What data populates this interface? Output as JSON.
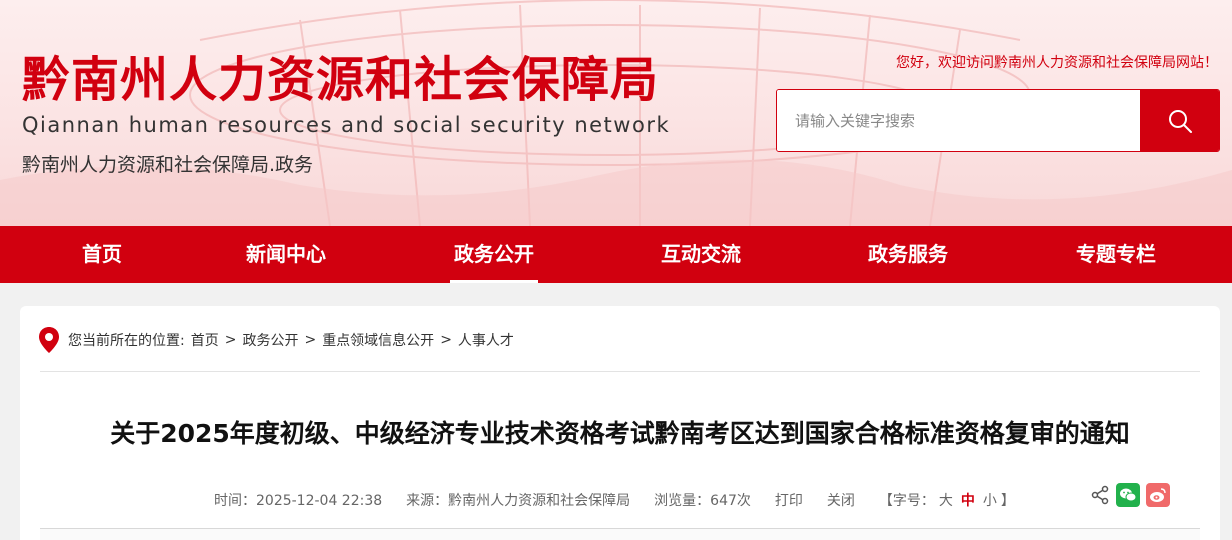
{
  "colors": {
    "brand": "#d1000f",
    "nav_bg": "#d1000f",
    "page_bg": "#f1f1f1"
  },
  "header": {
    "title": "黔南州人力资源和社会保障局",
    "title_en": "Qiannan human resources and social security network",
    "subtitle": "黔南州人力资源和社会保障局.政务",
    "welcome": "您好，欢迎访问黔南州人力资源和社会保障局网站！",
    "search": {
      "placeholder": "请输入关键字搜索",
      "value": "",
      "button_icon": "search-icon"
    }
  },
  "nav": {
    "items": [
      {
        "label": "首页"
      },
      {
        "label": "新闻中心"
      },
      {
        "label": "政务公开"
      },
      {
        "label": "互动交流"
      },
      {
        "label": "政务服务"
      },
      {
        "label": "专题专栏"
      }
    ],
    "active": "政务公开"
  },
  "breadcrumb": {
    "prefix": "您当前所在的位置:",
    "items": [
      "首页",
      "政务公开",
      "重点领域信息公开",
      "人事人才"
    ],
    "separator": ">"
  },
  "article": {
    "title": "关于2025年度初级、中级经济专业技术资格考试黔南考区达到国家合格标准资格复审的通知",
    "time": "时间：2025-12-04 22:38",
    "source": "来源：黔南州人力资源和社会保障局",
    "views": "浏览量：647次",
    "print_label": "打印",
    "close_label": "关闭",
    "font_size": {
      "prefix": "【字号：",
      "large": "大",
      "medium": "中",
      "small": "小",
      "suffix": "】",
      "current": "中"
    }
  },
  "share": {
    "icons": [
      "share-icon",
      "wechat-icon",
      "weibo-icon"
    ]
  }
}
